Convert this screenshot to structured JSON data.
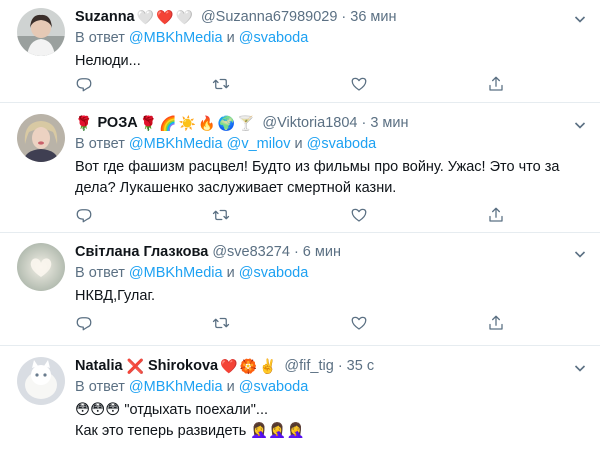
{
  "tweets": [
    {
      "name": "Suzanna",
      "name_emojis": [
        "🤍",
        "❤️",
        "🤍"
      ],
      "handle": "@Suzanna67989029",
      "time": "36 мин",
      "reply_prefix": "В ответ",
      "reply_user1": "@MBKhMedia",
      "reply_and": "и",
      "reply_user2": "@svaboda",
      "lines": [
        "Нелюди..."
      ]
    },
    {
      "name": "РОЗА",
      "name_pre_emojis": [
        "🌹"
      ],
      "name_emojis": [
        "🌹",
        "🌈",
        "☀️",
        "🔥",
        "🌍",
        "🍸"
      ],
      "handle": "@Viktoria1804",
      "time": "3 мин",
      "reply_prefix": "В ответ",
      "reply_user1": "@MBKhMedia",
      "reply_user_mid": "@v_milov",
      "reply_and": "и",
      "reply_user2": "@svaboda",
      "lines": [
        "Вот где фашизм расцвел! Будто из фильмы про войну. Ужас! Это что за",
        "дела? Лукашенко заслуживает смертной казни."
      ]
    },
    {
      "name": "Світлана Глазкова",
      "handle": "@sve83274",
      "time": "6 мин",
      "reply_prefix": "В ответ",
      "reply_user1": "@MBKhMedia",
      "reply_and": "и",
      "reply_user2": "@svaboda",
      "lines": [
        "НКВД,Гулаг."
      ]
    },
    {
      "name_first": "Natalia",
      "name_cross": "❌",
      "name_last": "Shirokova",
      "name_emojis": [
        "❤️",
        "🏵️",
        "✌️"
      ],
      "handle": "@fif_tig",
      "time": "35 с",
      "reply_prefix": "В ответ",
      "reply_user1": "@MBKhMedia",
      "reply_and": "и",
      "reply_user2": "@svaboda",
      "line1_emojis": [
        "😳",
        "😳",
        "😳"
      ],
      "line1_text": "\"отдыхать поехали\"...",
      "line2_text": "Как это теперь развидеть",
      "line2_emojis": [
        "🤦‍♀️",
        "🤦‍♀️",
        "🤦‍♀️"
      ]
    }
  ],
  "colors": {
    "link": "#1da1f2",
    "muted": "#5b7083",
    "divider": "#e6ecf0"
  },
  "icons": [
    "chevron-down-icon",
    "reply-icon",
    "retweet-icon",
    "like-icon",
    "share-icon"
  ]
}
